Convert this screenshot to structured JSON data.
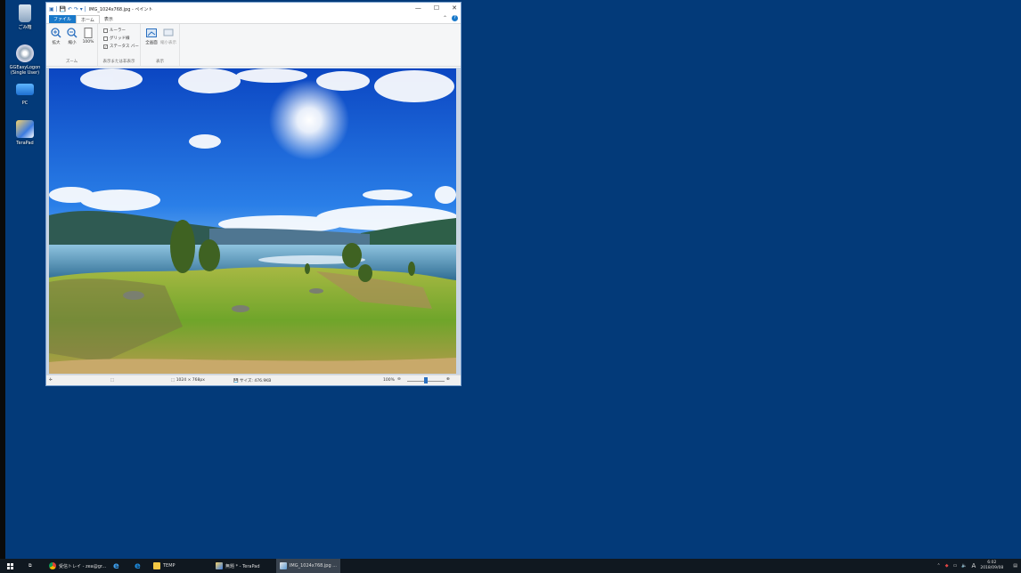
{
  "desktop_icons": [
    {
      "name": "recycle-bin",
      "label": "ごみ箱"
    },
    {
      "name": "ggeasylogon",
      "label": "GGEasyLogon\n(Single User)"
    },
    {
      "name": "pc",
      "label": "PC"
    },
    {
      "name": "terapad",
      "label": "TeraPad"
    }
  ],
  "paint": {
    "title": "IMG_1024x768.jpg - ペイント",
    "tabs": [
      "ファイル",
      "ホーム",
      "表示"
    ],
    "ribbon": {
      "zoom_in": "拡大",
      "zoom_out": "縮小",
      "zoom_100": "100%",
      "zoom_group": "ズーム",
      "ruler": "ルーラー",
      "gridlines": "グリッド線",
      "statusbar_chk": "ステータス バー",
      "show_group": "表示または非表示",
      "fullscreen": "全画面",
      "thumbnail": "縮小表示",
      "display_group": "表示"
    },
    "status": {
      "dimensions": "1024 × 768px",
      "size": "サイズ: 476.9KB",
      "zoom": "100%"
    }
  },
  "taskbar": {
    "items": [
      {
        "label": "受信トレイ - zea@gr...",
        "icon": "chrome-icon"
      },
      {
        "label": "",
        "icon": "ie-icon"
      },
      {
        "label": "",
        "icon": "edge-icon"
      },
      {
        "label": "TEMP",
        "icon": "folder-icon"
      },
      {
        "label": "無題 * - TeraPad",
        "icon": "terapad-icon"
      },
      {
        "label": "IMG_1024x768.jpg ...",
        "icon": "paint-icon"
      }
    ],
    "ime": "A",
    "time": "6:02",
    "date": "2018/09/08"
  }
}
